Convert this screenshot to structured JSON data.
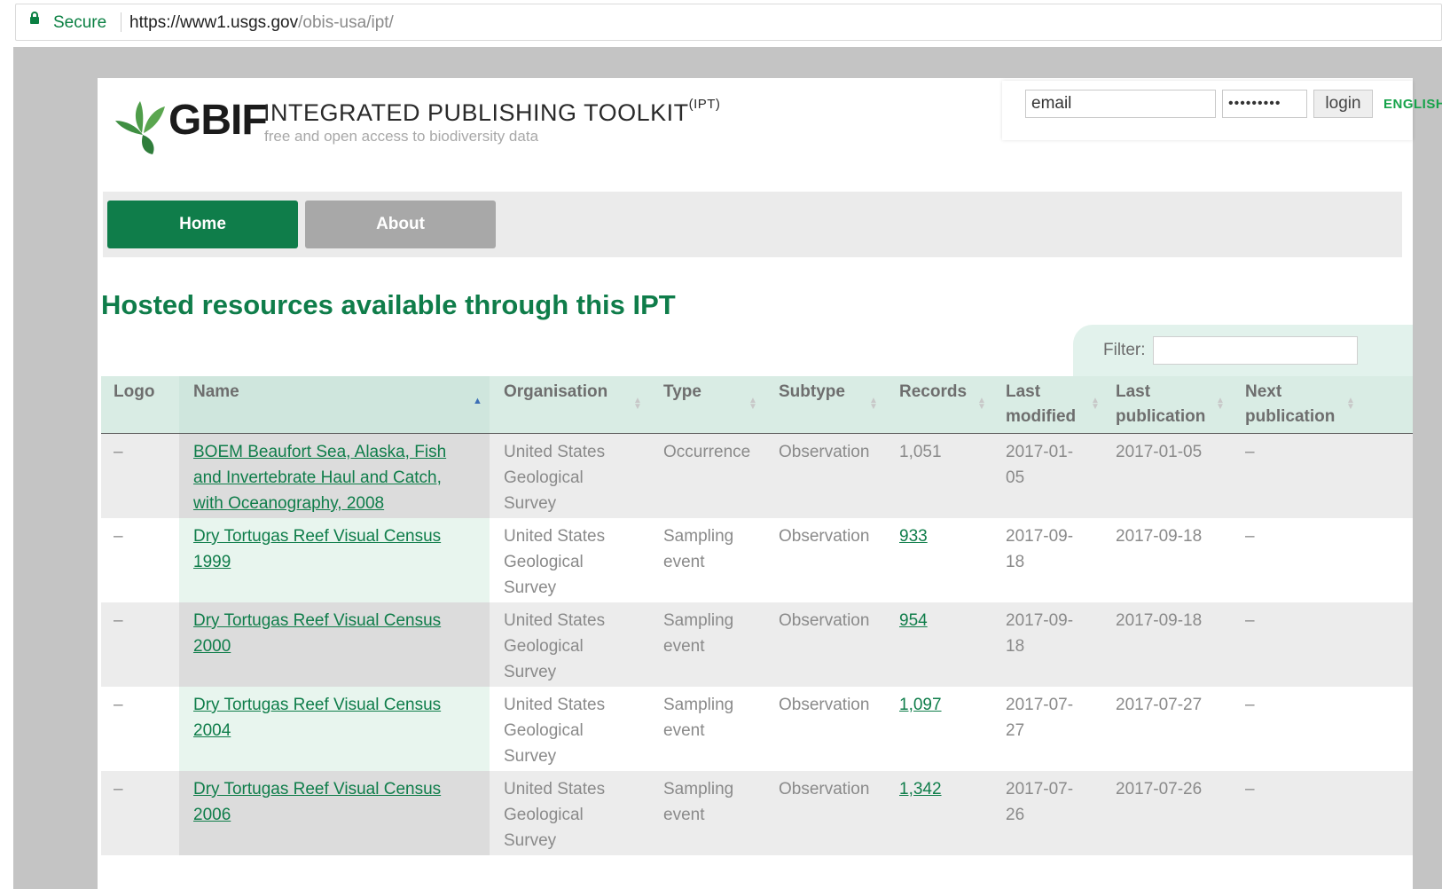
{
  "browser": {
    "secure_label": "Secure",
    "url_main": "https://www1.usgs.gov",
    "url_path": "/obis-usa/ipt/"
  },
  "header": {
    "logo_text": "GBIF",
    "title": "INTEGRATED PUBLISHING TOOLKIT",
    "title_sup": "(IPT)",
    "tagline": "free and open access to biodiversity data",
    "email_placeholder": "email",
    "password_value": "•••••••••",
    "login_label": "login",
    "language": "ENGLISH"
  },
  "nav": {
    "home": "Home",
    "about": "About"
  },
  "page_title": "Hosted resources available through this IPT",
  "filter_label": "Filter:",
  "table": {
    "headers": {
      "logo": "Logo",
      "name": "Name",
      "organisation": "Organisation",
      "type": "Type",
      "subtype": "Subtype",
      "records": "Records",
      "last_modified_1": "Last",
      "last_modified_2": "modified",
      "last_publication_1": "Last",
      "last_publication_2": "publication",
      "next_publication_1": "Next",
      "next_publication_2": "publication"
    },
    "rows": [
      {
        "logo": "–",
        "name": [
          "BOEM Beaufort Sea, Alaska, Fish",
          "and Invertebrate Haul and Catch,",
          "with Oceanography, 2008"
        ],
        "org": [
          "United States",
          "Geological",
          "Survey"
        ],
        "type": [
          "Occurrence"
        ],
        "subtype": "Observation",
        "records": "1,051",
        "last_modified": [
          "2017-01-",
          "05"
        ],
        "last_publication": "2017-01-05",
        "next_publication": "–"
      },
      {
        "logo": "–",
        "name": [
          "Dry Tortugas Reef Visual Census",
          "1999"
        ],
        "org": [
          "United States",
          "Geological",
          "Survey"
        ],
        "type": [
          "Sampling",
          "event"
        ],
        "subtype": "Observation",
        "records": "933",
        "last_modified": [
          "2017-09-",
          "18"
        ],
        "last_publication": "2017-09-18",
        "next_publication": "–"
      },
      {
        "logo": "–",
        "name": [
          "Dry Tortugas Reef Visual Census",
          "2000"
        ],
        "org": [
          "United States",
          "Geological",
          "Survey"
        ],
        "type": [
          "Sampling",
          "event"
        ],
        "subtype": "Observation",
        "records": "954",
        "last_modified": [
          "2017-09-",
          "18"
        ],
        "last_publication": "2017-09-18",
        "next_publication": "–"
      },
      {
        "logo": "–",
        "name": [
          "Dry Tortugas Reef Visual Census",
          "2004"
        ],
        "org": [
          "United States",
          "Geological",
          "Survey"
        ],
        "type": [
          "Sampling",
          "event"
        ],
        "subtype": "Observation",
        "records": "1,097",
        "last_modified": [
          "2017-07-",
          "27"
        ],
        "last_publication": "2017-07-27",
        "next_publication": "–"
      },
      {
        "logo": "–",
        "name": [
          "Dry Tortugas Reef Visual Census",
          "2006"
        ],
        "org": [
          "United States",
          "Geological",
          "Survey"
        ],
        "type": [
          "Sampling",
          "event"
        ],
        "subtype": "Observation",
        "records": "1,342",
        "last_modified": [
          "2017-07-",
          "26"
        ],
        "last_publication": "2017-07-26",
        "next_publication": "–"
      }
    ]
  },
  "colors": {
    "brand_green": "#0f7d4a",
    "secure_green": "#0b8043",
    "language_green": "#16a34a",
    "header_row": "#d9ece4"
  }
}
